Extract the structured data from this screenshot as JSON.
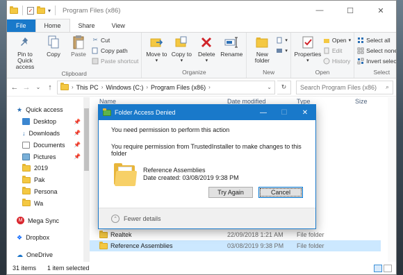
{
  "window": {
    "title": "Program Files (x86)"
  },
  "tabs": [
    "File",
    "Home",
    "Share",
    "View"
  ],
  "ribbon": {
    "clipboard": {
      "label": "Clipboard",
      "pin": "Pin to Quick access",
      "copy": "Copy",
      "paste": "Paste",
      "cut": "Cut",
      "copy_path": "Copy path",
      "paste_shortcut": "Paste shortcut"
    },
    "organize": {
      "label": "Organize",
      "move_to": "Move to",
      "copy_to": "Copy to",
      "delete": "Delete",
      "rename": "Rename"
    },
    "new": {
      "label": "New",
      "new_folder": "New folder"
    },
    "open": {
      "label": "Open",
      "properties": "Properties",
      "open": "Open",
      "edit": "Edit",
      "history": "History"
    },
    "select": {
      "label": "Select",
      "select_all": "Select all",
      "select_none": "Select none",
      "invert": "Invert selection"
    }
  },
  "address": {
    "crumbs": [
      "This PC",
      "Windows (C:)",
      "Program Files (x86)"
    ],
    "search_placeholder": "Search Program Files (x86)"
  },
  "sidebar": [
    {
      "label": "Quick access",
      "icon": "star-icon",
      "level": 1
    },
    {
      "label": "Desktop",
      "icon": "desktop-icon",
      "level": 2,
      "pinned": true
    },
    {
      "label": "Downloads",
      "icon": "download-icon",
      "level": 2,
      "pinned": true
    },
    {
      "label": "Documents",
      "icon": "documents-icon",
      "level": 2,
      "pinned": true
    },
    {
      "label": "Pictures",
      "icon": "pictures-icon",
      "level": 2,
      "pinned": true
    },
    {
      "label": "2019",
      "icon": "folder-icon",
      "level": 2
    },
    {
      "label": "Pak",
      "icon": "folder-icon",
      "level": 2
    },
    {
      "label": "Persona",
      "icon": "folder-icon",
      "level": 2
    },
    {
      "label": "Wa",
      "icon": "folder-icon",
      "level": 2
    },
    {
      "label": "Mega Sync",
      "icon": "mega-icon",
      "level": 1
    },
    {
      "label": "Dropbox",
      "icon": "dropbox-icon",
      "level": 1
    },
    {
      "label": "OneDrive",
      "icon": "onedrive-icon",
      "level": 1
    }
  ],
  "columns": {
    "name": "Name",
    "date": "Date modified",
    "type": "Type",
    "size": "Size"
  },
  "files": [
    {
      "name": "Realtek",
      "date": "22/09/2018 1:21 AM",
      "type": "File folder"
    },
    {
      "name": "Reference Assemblies",
      "date": "03/08/2019 9:38 PM",
      "type": "File folder",
      "selected": true
    }
  ],
  "status": {
    "items": "31 items",
    "selected": "1 item selected"
  },
  "dialog": {
    "title": "Folder Access Denied",
    "heading": "You need permission to perform this action",
    "message": "You require permission from TrustedInstaller to make changes to this folder",
    "file_name": "Reference Assemblies",
    "file_date": "Date created: 03/08/2019 9:38 PM",
    "try_again": "Try Again",
    "cancel": "Cancel",
    "fewer_details": "Fewer details"
  },
  "colors": {
    "accent": "#1979ca",
    "selection": "#cce8ff",
    "folder": "#f4c842"
  }
}
